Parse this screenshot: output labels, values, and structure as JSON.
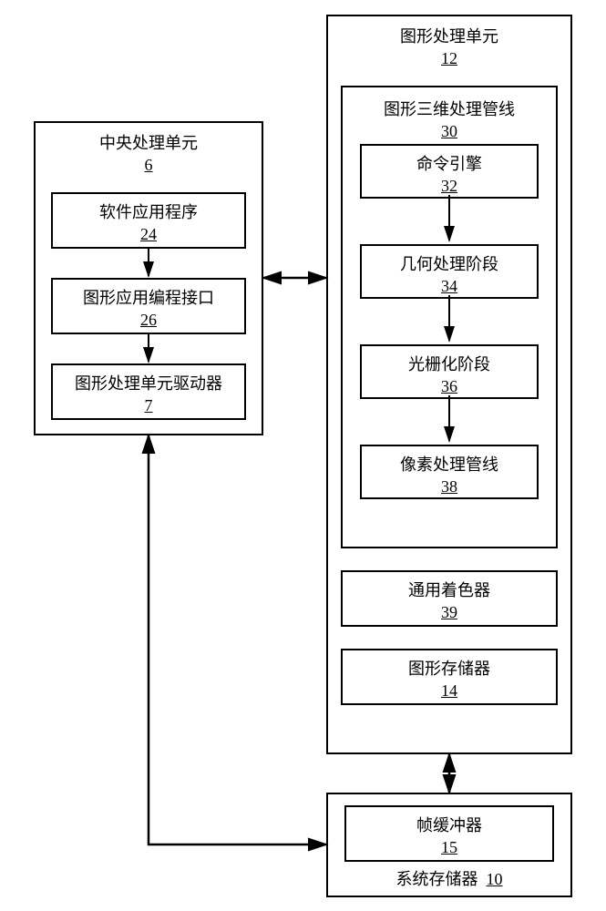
{
  "cpu": {
    "title": "中央处理单元",
    "num": "6",
    "software": {
      "label": "软件应用程序",
      "num": "24"
    },
    "api": {
      "label": "图形应用编程接口",
      "num": "26"
    },
    "driver": {
      "label": "图形处理单元驱动器",
      "num": "7"
    }
  },
  "gpu": {
    "title": "图形处理单元",
    "num": "12",
    "pipeline": {
      "title": "图形三维处理管线",
      "num": "30",
      "cmd": {
        "label": "命令引擎",
        "num": "32"
      },
      "geom": {
        "label": "几何处理阶段",
        "num": "34"
      },
      "raster": {
        "label": "光栅化阶段",
        "num": "36"
      },
      "pixel": {
        "label": "像素处理管线",
        "num": "38"
      }
    },
    "shader": {
      "label": "通用着色器",
      "num": "39"
    },
    "gmem": {
      "label": "图形存储器",
      "num": "14"
    }
  },
  "sysmem": {
    "title": "系统存储器",
    "num": "10",
    "framebuf": {
      "label": "帧缓冲器",
      "num": "15"
    }
  }
}
